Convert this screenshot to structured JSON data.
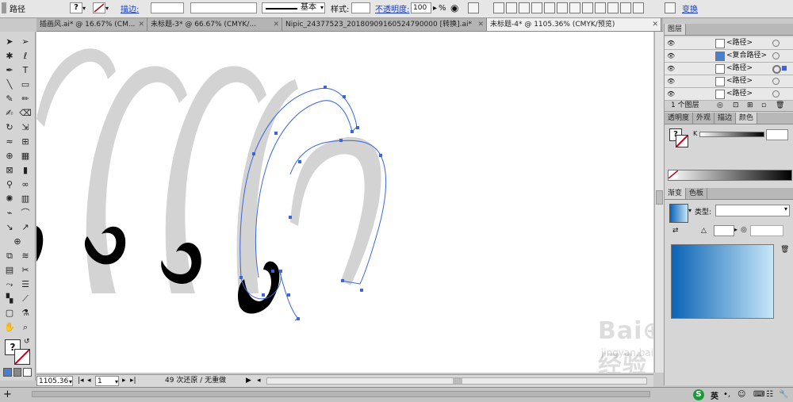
{
  "control_bar": {
    "selection_label": "路径",
    "stroke_label": "描边:",
    "stroke_profile": "基本",
    "style_label": "样式:",
    "opacity_label": "不透明度:",
    "opacity_value": "100",
    "opacity_unit": "%",
    "transform_label": "变换"
  },
  "tabs": [
    {
      "label": "插画风.ai* @ 16.67% (CM...",
      "active": false
    },
    {
      "label": "未标题-3* @ 66.67% (CMYK/...",
      "active": false
    },
    {
      "label": "Nipic_24377523_20180909160524790000 [转换].ai*",
      "active": false
    },
    {
      "label": "未标题-4* @ 1105.36% (CMYK/预览)",
      "active": true
    }
  ],
  "status_bar": {
    "zoom": "1105.36",
    "page": "1",
    "history": "49 次还原 / 无重做"
  },
  "layers_panel": {
    "title": "图层",
    "rows": [
      {
        "name": "<路径>"
      },
      {
        "name": "<复合路径>"
      },
      {
        "name": "<路径>"
      },
      {
        "name": "<路径>"
      },
      {
        "name": "<路径>"
      }
    ],
    "footer_count": "1 个图层"
  },
  "color_panel": {
    "tabs": [
      "透明度",
      "外观",
      "描边",
      "颜色"
    ],
    "active_tab": "颜色",
    "channel_label": "K"
  },
  "gradient_panel": {
    "tabs": [
      "渐变",
      "色板"
    ],
    "active_tab": "渐变",
    "type_label": "类型:",
    "gradient_start": "#0a63b5",
    "gradient_end": "#c8e7f8"
  },
  "taskbar": {
    "ime_label": "英"
  },
  "colors": {
    "accent": "#1b3fbf",
    "path_selection": "#3a66d9",
    "shape_gray": "#d3d3d3"
  }
}
